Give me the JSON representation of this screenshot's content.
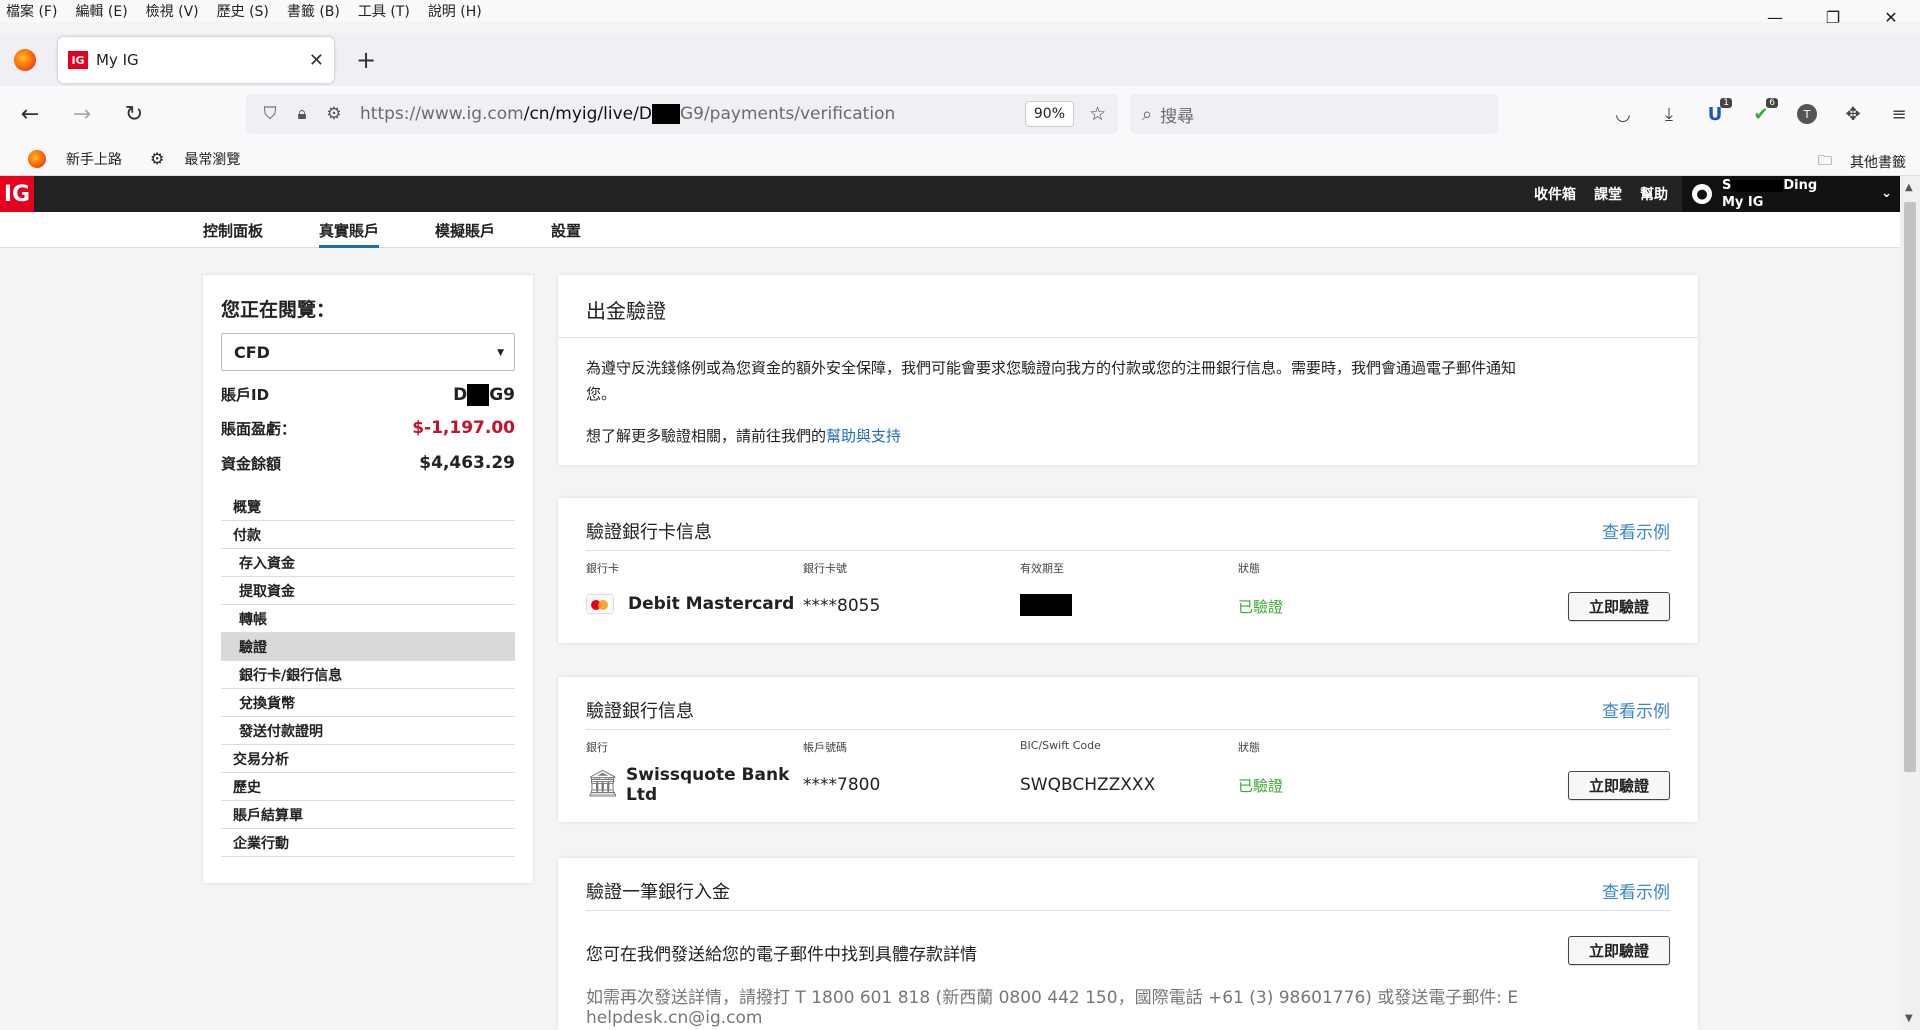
{
  "menubar": {
    "items": [
      "檔案 (F)",
      "編輯 (E)",
      "檢視 (V)",
      "歷史 (S)",
      "書籤 (B)",
      "工具 (T)",
      "說明 (H)"
    ]
  },
  "window_controls": {
    "minimize": "—",
    "restore": "❐",
    "close": "✕"
  },
  "tab": {
    "favicon": "IG",
    "title": "My IG",
    "close": "✕",
    "new_tab": "+",
    "tab_list": "⌄"
  },
  "nav": {
    "back": "←",
    "forward": "→",
    "reload": "↻"
  },
  "url": {
    "prefix": "https://www.ig.com",
    "path_a": "/cn/myig/live/D",
    "path_b": "G9/payments/verification",
    "zoom": "90%"
  },
  "search": {
    "placeholder": "搜尋"
  },
  "toolbar": {
    "badge1": "1",
    "badge2": "6",
    "avatar_letter": "T"
  },
  "bookmarks": {
    "item1": "新手上路",
    "item2": "最常瀏覽",
    "other": "其他書籤"
  },
  "ig_header": {
    "logo": "IG",
    "links": [
      "收件箱",
      "課堂",
      "幫助"
    ],
    "acct_name_start": "S",
    "acct_name_end": "Ding",
    "acct_label": "My IG"
  },
  "subnav": {
    "items": [
      "控制面板",
      "真實賬戶",
      "模擬賬戶",
      "設置"
    ],
    "active": 1
  },
  "sidebar": {
    "title": "您正在閱覽：",
    "select_value": "CFD",
    "account_id_label": "賬戶ID",
    "account_id_start": "D",
    "account_id_end": "G9",
    "pnl_label": "賬面盈虧：",
    "pnl_value": "$-1,197.00",
    "balance_label": "資金餘額",
    "balance_value": "$4,463.29",
    "menu": [
      "概覽",
      "付款",
      "存入資金",
      "提取資金",
      "轉帳",
      "驗證",
      "銀行卡/銀行信息",
      "兌換貨幣",
      "發送付款證明",
      "交易分析",
      "歷史",
      "賬戶結算單",
      "企業行動"
    ]
  },
  "intro": {
    "title": "出金驗證",
    "para1_line1": "為遵守反洗錢條例或為您資金的額外安全保障，我們可能會要求您驗證向我方的付款或您的注冊銀行信息。需要時，我們會通過電子郵件通知",
    "para1_line2": "您。",
    "para2": "想了解更多驗證相關，請前往我們的",
    "para2_link": "幫助與支持"
  },
  "card_verify": {
    "title": "驗證銀行卡信息",
    "example": "查看示例",
    "cols": [
      "銀行卡",
      "銀行卡號",
      "有效期至",
      "狀態"
    ],
    "card_name": "Debit Mastercard",
    "card_number": "****8055",
    "status": "已驗證",
    "button": "立即驗證"
  },
  "bank_verify": {
    "title": "驗證銀行信息",
    "example": "查看示例",
    "cols": [
      "銀行",
      "帳戶號碼",
      "BIC/Swift Code",
      "狀態"
    ],
    "bank_name_1": "Swissquote Bank",
    "bank_name_2": "Ltd",
    "account_number": "****7800",
    "swift": "SWQBCHZZXXX",
    "status": "已驗證",
    "button": "立即驗證"
  },
  "deposit_verify": {
    "title": "驗證一筆銀行入金",
    "example": "查看示例",
    "text": "您可在我們發送給您的電子郵件中找到具體存款詳情",
    "button": "立即驗證",
    "help_line1": "如需再次發送詳情，請撥打 T 1800 601 818 (新西蘭 0800 442 150，國際電話 +61 (3) 98601776) 或發送電子郵件: E",
    "help_line2": "helpdesk.cn@ig.com"
  },
  "colors": {
    "brand_red": "#e6001f",
    "link_blue": "#1f6ab8",
    "verified_green": "#3aaa35",
    "negative_red": "#c8102e"
  }
}
